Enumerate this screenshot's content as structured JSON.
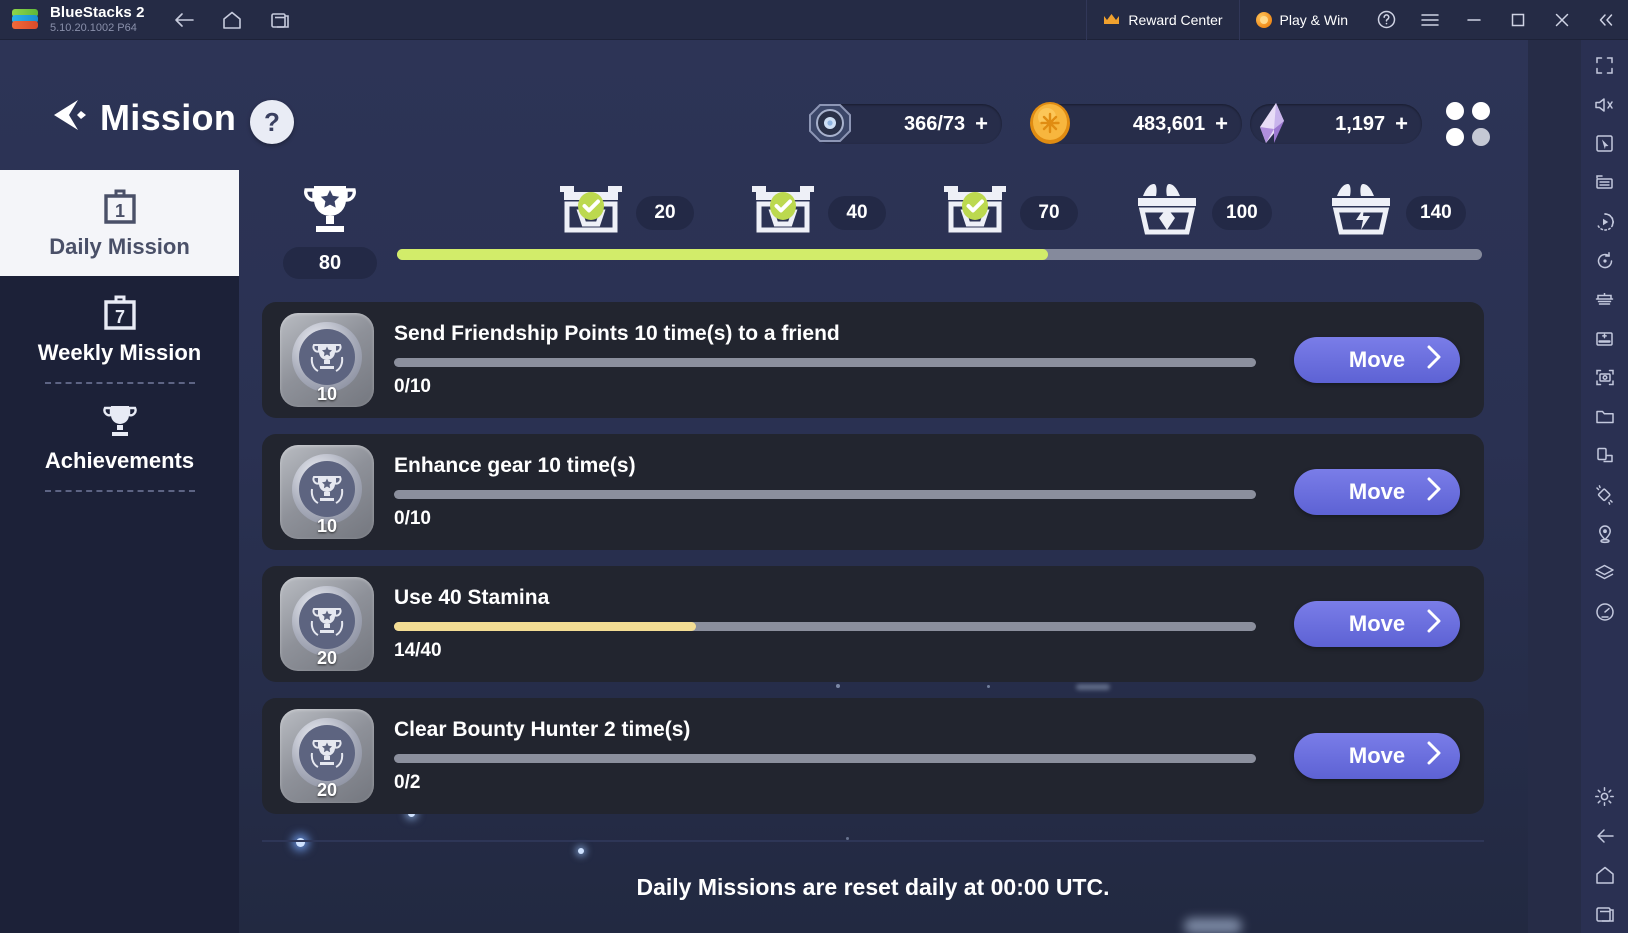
{
  "titlebar": {
    "app_name": "BlueStacks 2",
    "version": "5.10.20.1002  P64",
    "nav": [
      {
        "name": "back-icon",
        "label": "Back"
      },
      {
        "name": "home-icon",
        "label": "Home"
      },
      {
        "name": "recents-icon",
        "label": "Recents"
      }
    ],
    "reward_center": "Reward Center",
    "play_and_win": "Play & Win",
    "window_controls": [
      "help-icon",
      "menu-icon",
      "minimize-icon",
      "maximize-icon",
      "close-icon",
      "collapse-icon"
    ]
  },
  "right_toolbar": {
    "icons": [
      "fullscreen-icon",
      "mute-icon",
      "pointer-icon",
      "keyboard-controls-icon",
      "macro-play-icon",
      "rotate-icon",
      "multi-instance-icon",
      "install-apk-icon",
      "screenshot-icon",
      "media-folder-icon",
      "screen-rotate-icon",
      "shake-icon",
      "location-icon",
      "layers-icon",
      "performance-icon"
    ],
    "bottom_icons": [
      "gear-icon",
      "back-icon",
      "home-icon",
      "recents-icon"
    ]
  },
  "game": {
    "header": {
      "back_icon": "back-arrow-icon",
      "title": "Mission",
      "help_label": "?",
      "currencies": [
        {
          "icon": "compass-token-icon",
          "value": "366/73",
          "plus": "+"
        },
        {
          "icon": "gold-coin-icon",
          "value": "483,601",
          "plus": "+"
        },
        {
          "icon": "crystal-gem-icon",
          "value": "1,197",
          "plus": "+"
        }
      ],
      "grid_button": "grid-menu-icon"
    },
    "progress": {
      "trophy_icon": "trophy-icon",
      "trophy_count": "80",
      "fill_percent": 60,
      "nodes": [
        {
          "label": "20",
          "claimed": true
        },
        {
          "label": "40",
          "claimed": true
        },
        {
          "label": "70",
          "claimed": true
        },
        {
          "label": "100",
          "claimed": false
        },
        {
          "label": "140",
          "claimed": false
        }
      ]
    },
    "tabs": [
      {
        "label": "Daily Mission",
        "icon": "calendar-1-icon",
        "active": true
      },
      {
        "label": "Weekly Mission",
        "icon": "calendar-7-icon",
        "active": false
      },
      {
        "label": "Achievements",
        "icon": "trophy-icon",
        "active": false
      }
    ],
    "missions": [
      {
        "title": "Send Friendship Points 10 time(s) to a friend",
        "count": "0/10",
        "reward": "10",
        "percent": 0,
        "button": "Move"
      },
      {
        "title": "Enhance gear 10 time(s)",
        "count": "0/10",
        "reward": "10",
        "percent": 0,
        "button": "Move"
      },
      {
        "title": "Use 40 Stamina",
        "count": "14/40",
        "reward": "20",
        "percent": 35,
        "button": "Move"
      },
      {
        "title": "Clear Bounty Hunter 2 time(s)",
        "count": "0/2",
        "reward": "20",
        "percent": 0,
        "button": "Move"
      }
    ],
    "footer_note": "Daily Missions are reset daily at 00:00 UTC."
  },
  "colors": {
    "accent_blue": "#6366d9",
    "progress_green": "#d2ec6a",
    "progress_yellow": "#f3dd94",
    "panel_dark": "#22252f",
    "game_bg": "#2b3353"
  }
}
